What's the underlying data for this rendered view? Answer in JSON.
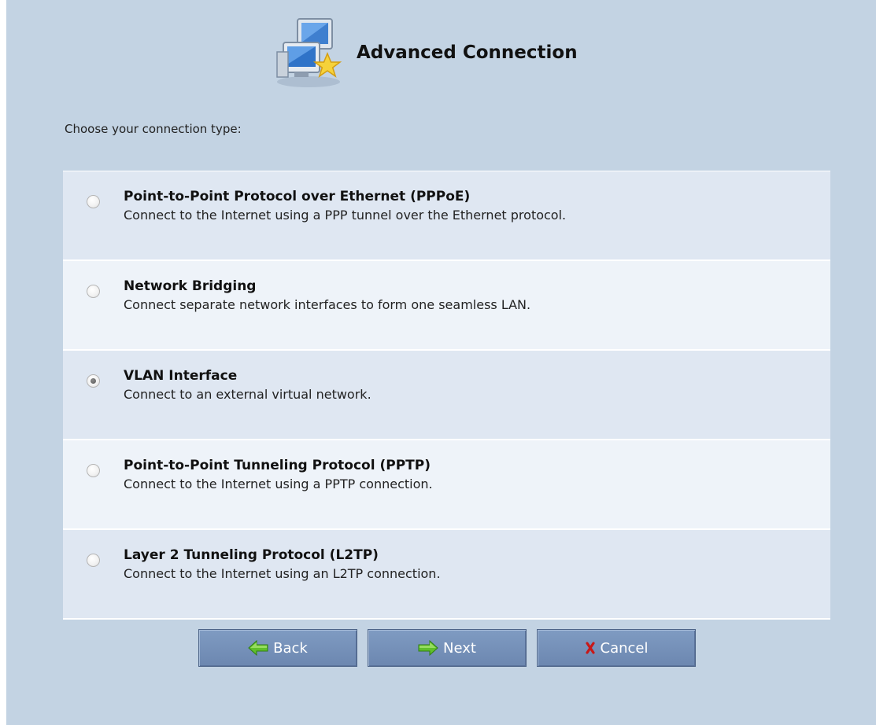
{
  "header": {
    "title": "Advanced Connection",
    "icon": "network-computers-icon"
  },
  "prompt": "Choose your connection type:",
  "options": [
    {
      "title": "Point-to-Point Protocol over Ethernet (PPPoE)",
      "description": "Connect to the Internet using a PPP tunnel over the Ethernet protocol.",
      "selected": false
    },
    {
      "title": "Network Bridging",
      "description": "Connect separate network interfaces to form one seamless LAN.",
      "selected": false
    },
    {
      "title": "VLAN Interface",
      "description": "Connect to an external virtual network.",
      "selected": true
    },
    {
      "title": "Point-to-Point Tunneling Protocol (PPTP)",
      "description": "Connect to the Internet using a PPTP connection.",
      "selected": false
    },
    {
      "title": "Layer 2 Tunneling Protocol (L2TP)",
      "description": "Connect to the Internet using an L2TP connection.",
      "selected": false
    }
  ],
  "buttons": {
    "back": {
      "label": "Back",
      "icon": "green-arrow-left-icon"
    },
    "next": {
      "label": "Next",
      "icon": "green-arrow-right-icon"
    },
    "cancel": {
      "label": "Cancel",
      "icon": "red-x-icon"
    }
  },
  "colors": {
    "panel_background": "#c3d3e3",
    "row_odd": "#dfe7f2",
    "row_even": "#eef3f9",
    "button": "#7590b8",
    "arrow_green": "#5fbf2a",
    "cancel_red": "#c81818"
  }
}
